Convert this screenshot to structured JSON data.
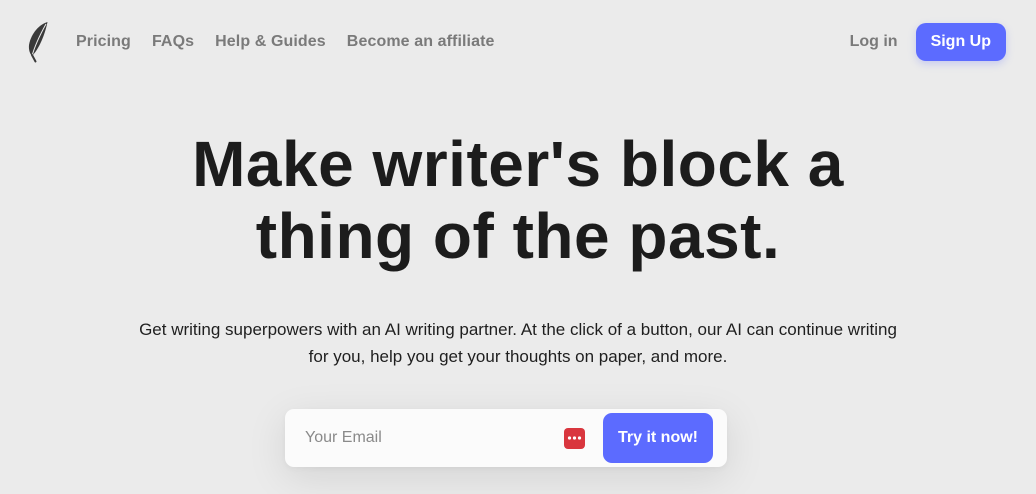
{
  "nav": {
    "links": [
      "Pricing",
      "FAQs",
      "Help & Guides",
      "Become an affiliate"
    ],
    "login_label": "Log in",
    "signup_label": "Sign Up"
  },
  "hero": {
    "headline_line1": "Make writer's block a",
    "headline_line2": "thing of the past.",
    "subtext": "Get writing superpowers with an AI writing partner. At the click of a button, our AI can continue writing for you, help you get your thoughts on paper, and more."
  },
  "form": {
    "email_placeholder": "Your Email",
    "email_value": "",
    "submit_label": "Try it now!"
  },
  "icons": {
    "logo": "feather-icon",
    "password_manager": "password-manager-icon"
  },
  "colors": {
    "accent": "#5c6bff",
    "background": "#ebebeb",
    "password_manager": "#d9363e"
  }
}
